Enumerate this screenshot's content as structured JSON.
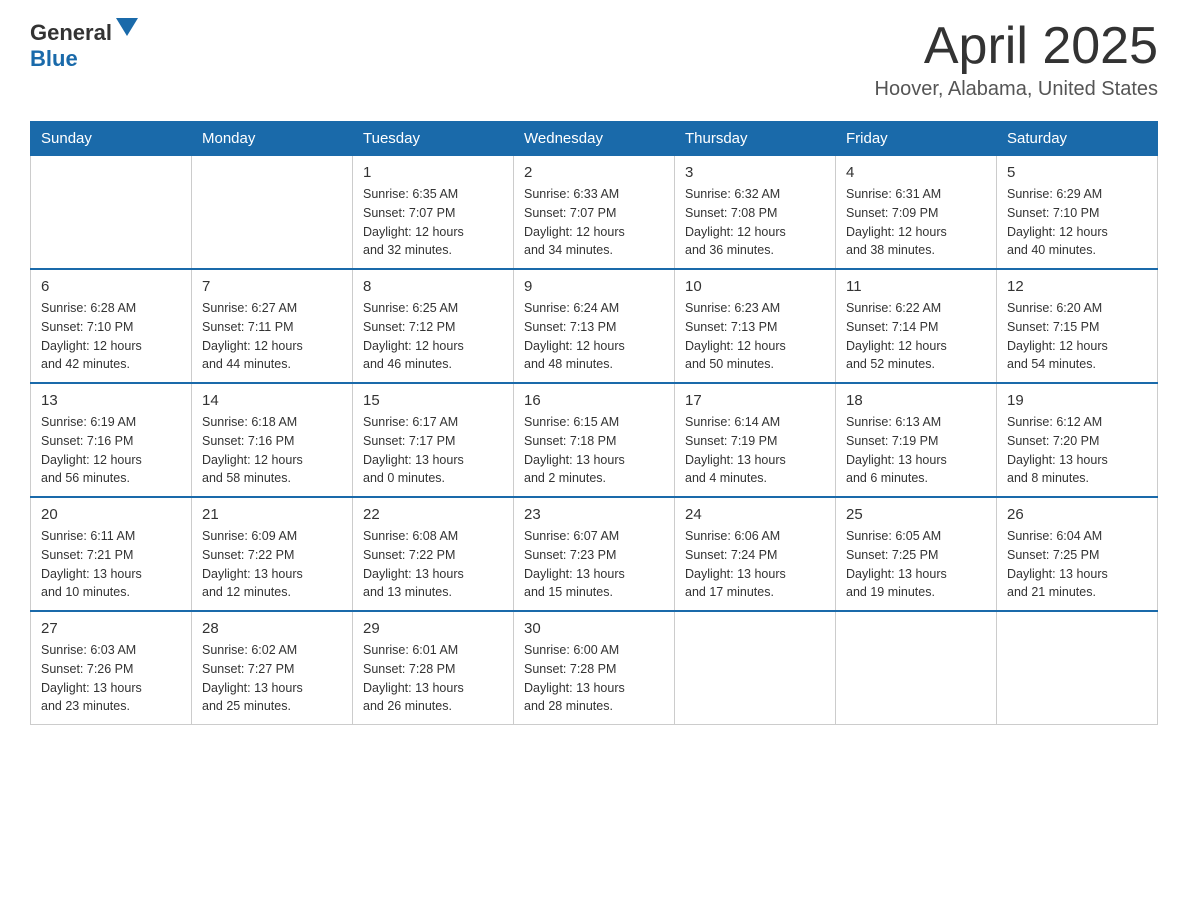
{
  "header": {
    "logo_general": "General",
    "logo_blue": "Blue",
    "title": "April 2025",
    "location": "Hoover, Alabama, United States"
  },
  "days_of_week": [
    "Sunday",
    "Monday",
    "Tuesday",
    "Wednesday",
    "Thursday",
    "Friday",
    "Saturday"
  ],
  "weeks": [
    [
      {
        "day": "",
        "info": ""
      },
      {
        "day": "",
        "info": ""
      },
      {
        "day": "1",
        "info": "Sunrise: 6:35 AM\nSunset: 7:07 PM\nDaylight: 12 hours\nand 32 minutes."
      },
      {
        "day": "2",
        "info": "Sunrise: 6:33 AM\nSunset: 7:07 PM\nDaylight: 12 hours\nand 34 minutes."
      },
      {
        "day": "3",
        "info": "Sunrise: 6:32 AM\nSunset: 7:08 PM\nDaylight: 12 hours\nand 36 minutes."
      },
      {
        "day": "4",
        "info": "Sunrise: 6:31 AM\nSunset: 7:09 PM\nDaylight: 12 hours\nand 38 minutes."
      },
      {
        "day": "5",
        "info": "Sunrise: 6:29 AM\nSunset: 7:10 PM\nDaylight: 12 hours\nand 40 minutes."
      }
    ],
    [
      {
        "day": "6",
        "info": "Sunrise: 6:28 AM\nSunset: 7:10 PM\nDaylight: 12 hours\nand 42 minutes."
      },
      {
        "day": "7",
        "info": "Sunrise: 6:27 AM\nSunset: 7:11 PM\nDaylight: 12 hours\nand 44 minutes."
      },
      {
        "day": "8",
        "info": "Sunrise: 6:25 AM\nSunset: 7:12 PM\nDaylight: 12 hours\nand 46 minutes."
      },
      {
        "day": "9",
        "info": "Sunrise: 6:24 AM\nSunset: 7:13 PM\nDaylight: 12 hours\nand 48 minutes."
      },
      {
        "day": "10",
        "info": "Sunrise: 6:23 AM\nSunset: 7:13 PM\nDaylight: 12 hours\nand 50 minutes."
      },
      {
        "day": "11",
        "info": "Sunrise: 6:22 AM\nSunset: 7:14 PM\nDaylight: 12 hours\nand 52 minutes."
      },
      {
        "day": "12",
        "info": "Sunrise: 6:20 AM\nSunset: 7:15 PM\nDaylight: 12 hours\nand 54 minutes."
      }
    ],
    [
      {
        "day": "13",
        "info": "Sunrise: 6:19 AM\nSunset: 7:16 PM\nDaylight: 12 hours\nand 56 minutes."
      },
      {
        "day": "14",
        "info": "Sunrise: 6:18 AM\nSunset: 7:16 PM\nDaylight: 12 hours\nand 58 minutes."
      },
      {
        "day": "15",
        "info": "Sunrise: 6:17 AM\nSunset: 7:17 PM\nDaylight: 13 hours\nand 0 minutes."
      },
      {
        "day": "16",
        "info": "Sunrise: 6:15 AM\nSunset: 7:18 PM\nDaylight: 13 hours\nand 2 minutes."
      },
      {
        "day": "17",
        "info": "Sunrise: 6:14 AM\nSunset: 7:19 PM\nDaylight: 13 hours\nand 4 minutes."
      },
      {
        "day": "18",
        "info": "Sunrise: 6:13 AM\nSunset: 7:19 PM\nDaylight: 13 hours\nand 6 minutes."
      },
      {
        "day": "19",
        "info": "Sunrise: 6:12 AM\nSunset: 7:20 PM\nDaylight: 13 hours\nand 8 minutes."
      }
    ],
    [
      {
        "day": "20",
        "info": "Sunrise: 6:11 AM\nSunset: 7:21 PM\nDaylight: 13 hours\nand 10 minutes."
      },
      {
        "day": "21",
        "info": "Sunrise: 6:09 AM\nSunset: 7:22 PM\nDaylight: 13 hours\nand 12 minutes."
      },
      {
        "day": "22",
        "info": "Sunrise: 6:08 AM\nSunset: 7:22 PM\nDaylight: 13 hours\nand 13 minutes."
      },
      {
        "day": "23",
        "info": "Sunrise: 6:07 AM\nSunset: 7:23 PM\nDaylight: 13 hours\nand 15 minutes."
      },
      {
        "day": "24",
        "info": "Sunrise: 6:06 AM\nSunset: 7:24 PM\nDaylight: 13 hours\nand 17 minutes."
      },
      {
        "day": "25",
        "info": "Sunrise: 6:05 AM\nSunset: 7:25 PM\nDaylight: 13 hours\nand 19 minutes."
      },
      {
        "day": "26",
        "info": "Sunrise: 6:04 AM\nSunset: 7:25 PM\nDaylight: 13 hours\nand 21 minutes."
      }
    ],
    [
      {
        "day": "27",
        "info": "Sunrise: 6:03 AM\nSunset: 7:26 PM\nDaylight: 13 hours\nand 23 minutes."
      },
      {
        "day": "28",
        "info": "Sunrise: 6:02 AM\nSunset: 7:27 PM\nDaylight: 13 hours\nand 25 minutes."
      },
      {
        "day": "29",
        "info": "Sunrise: 6:01 AM\nSunset: 7:28 PM\nDaylight: 13 hours\nand 26 minutes."
      },
      {
        "day": "30",
        "info": "Sunrise: 6:00 AM\nSunset: 7:28 PM\nDaylight: 13 hours\nand 28 minutes."
      },
      {
        "day": "",
        "info": ""
      },
      {
        "day": "",
        "info": ""
      },
      {
        "day": "",
        "info": ""
      }
    ]
  ]
}
